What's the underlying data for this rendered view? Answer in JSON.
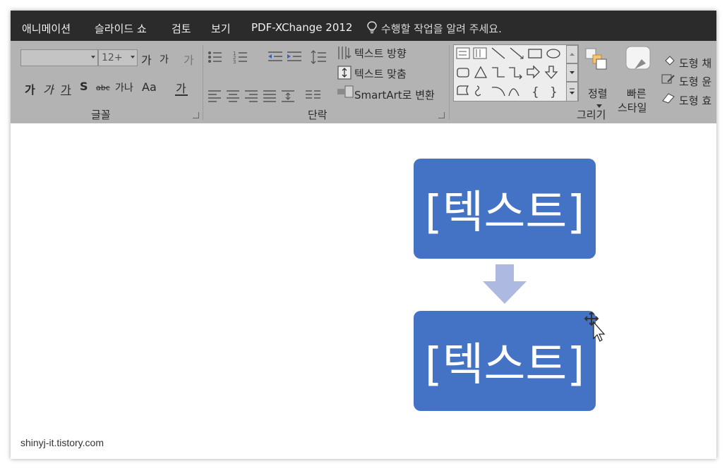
{
  "tabs": [
    "애니메이션",
    "슬라이드 쇼",
    "검토",
    "보기",
    "PDF-XChange 2012"
  ],
  "tell_me": "수행할 작업을 알려 주세요.",
  "ribbon": {
    "font_group": {
      "label": "글꼴",
      "font_size_value": "12+",
      "grow_font": "가",
      "shrink_font": "가",
      "clear_format": "가",
      "bold": "가",
      "italic": "가",
      "underline": "가",
      "shadow": "S",
      "strikethrough": "abc",
      "spacing": "가나",
      "change_case": "Aa",
      "font_color": "가"
    },
    "paragraph_group": {
      "label": "단락",
      "text_direction": "텍스트 방향",
      "align_text": "텍스트 맞춤",
      "smartart": "SmartArt로 변환"
    },
    "drawing_group": {
      "label": "그리기",
      "arrange": "정렬",
      "quick_styles_1": "빠른",
      "quick_styles_2": "스타일",
      "shape_fill": "도형 채",
      "shape_outline": "도형 윤",
      "shape_effects": "도형 효"
    }
  },
  "slide": {
    "box1_text": "[텍스트]",
    "box2_text": "[텍스트]",
    "colors": {
      "box": "#4472c4",
      "arrow": "#adb9e0"
    }
  },
  "watermark": "shinyj-it.tistory.com"
}
